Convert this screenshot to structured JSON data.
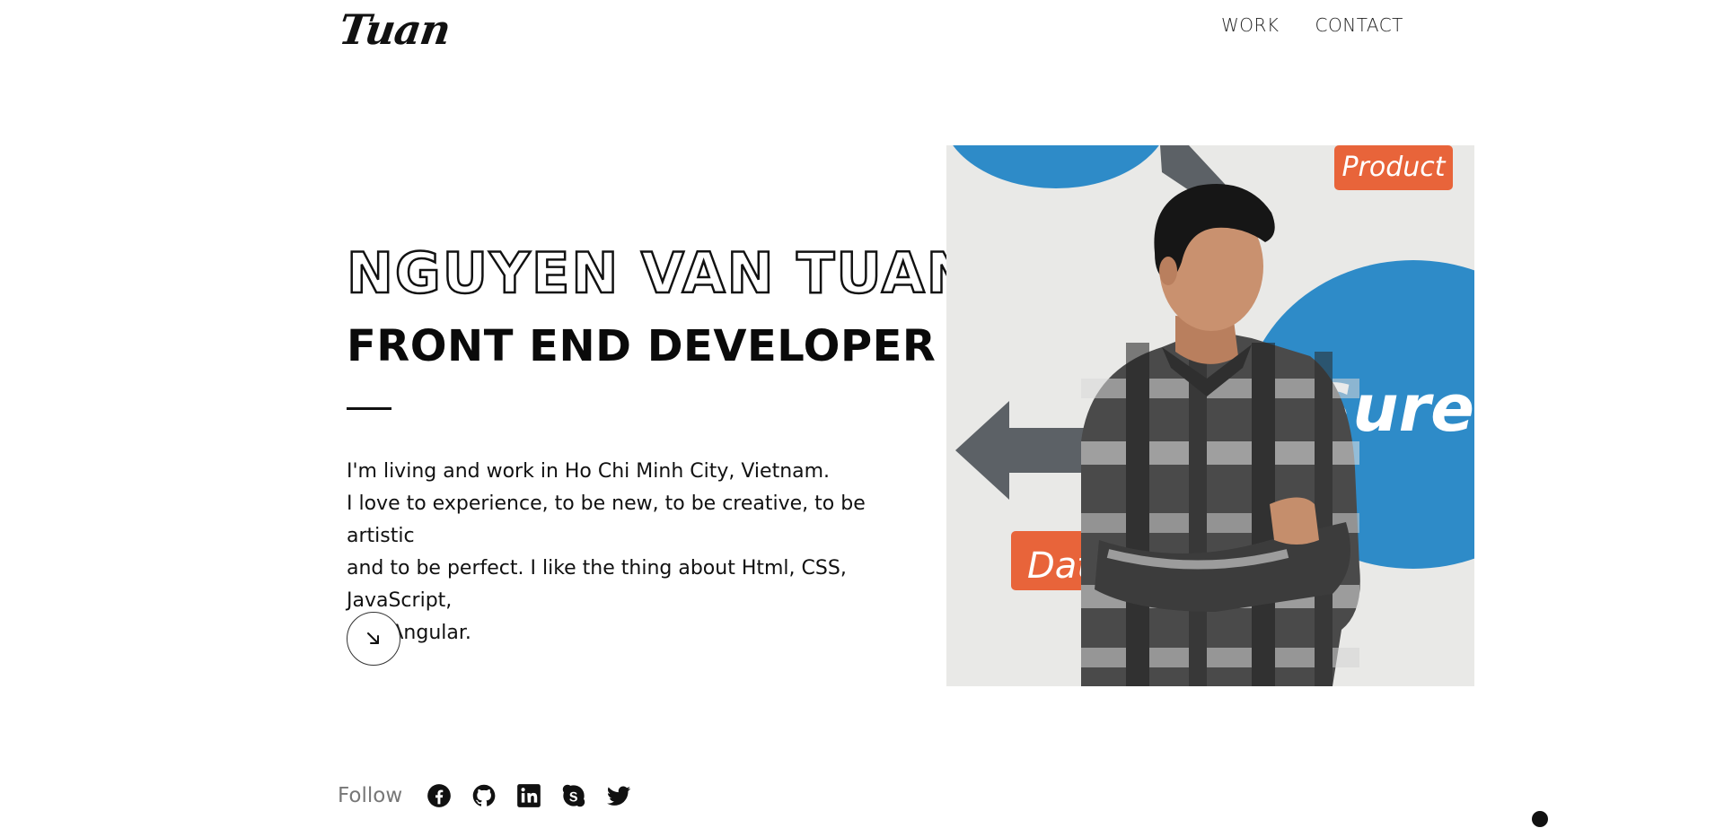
{
  "header": {
    "logo_text": "Tuan",
    "nav": [
      {
        "label": "WORK"
      },
      {
        "label": "CONTACT"
      }
    ]
  },
  "hero": {
    "name": "NGUYEN VAN TUAN",
    "role": "FRONT END DEVELOPER",
    "bio": [
      "I'm living and work in Ho Chi Minh City, Vietnam.",
      "I love to experience, to be new, to be creative, to be artistic",
      "and to be perfect. I like the thing about Html, CSS, JavaScript,",
      "and Angular."
    ],
    "scroll_button_icon": "arrow-down-right-icon"
  },
  "photo": {
    "wall_labels": {
      "product": "Product",
      "measure": "eaSure",
      "data": "Data"
    },
    "colors": {
      "wall": "#e9e9e7",
      "blue": "#2e8bc8",
      "orange": "#e8643a",
      "arrow_gray": "#5c6166"
    }
  },
  "footer": {
    "follow_label": "Follow",
    "socials": [
      {
        "name": "facebook-icon"
      },
      {
        "name": "github-icon"
      },
      {
        "name": "linkedin-icon"
      },
      {
        "name": "skype-icon"
      },
      {
        "name": "twitter-icon"
      }
    ]
  }
}
